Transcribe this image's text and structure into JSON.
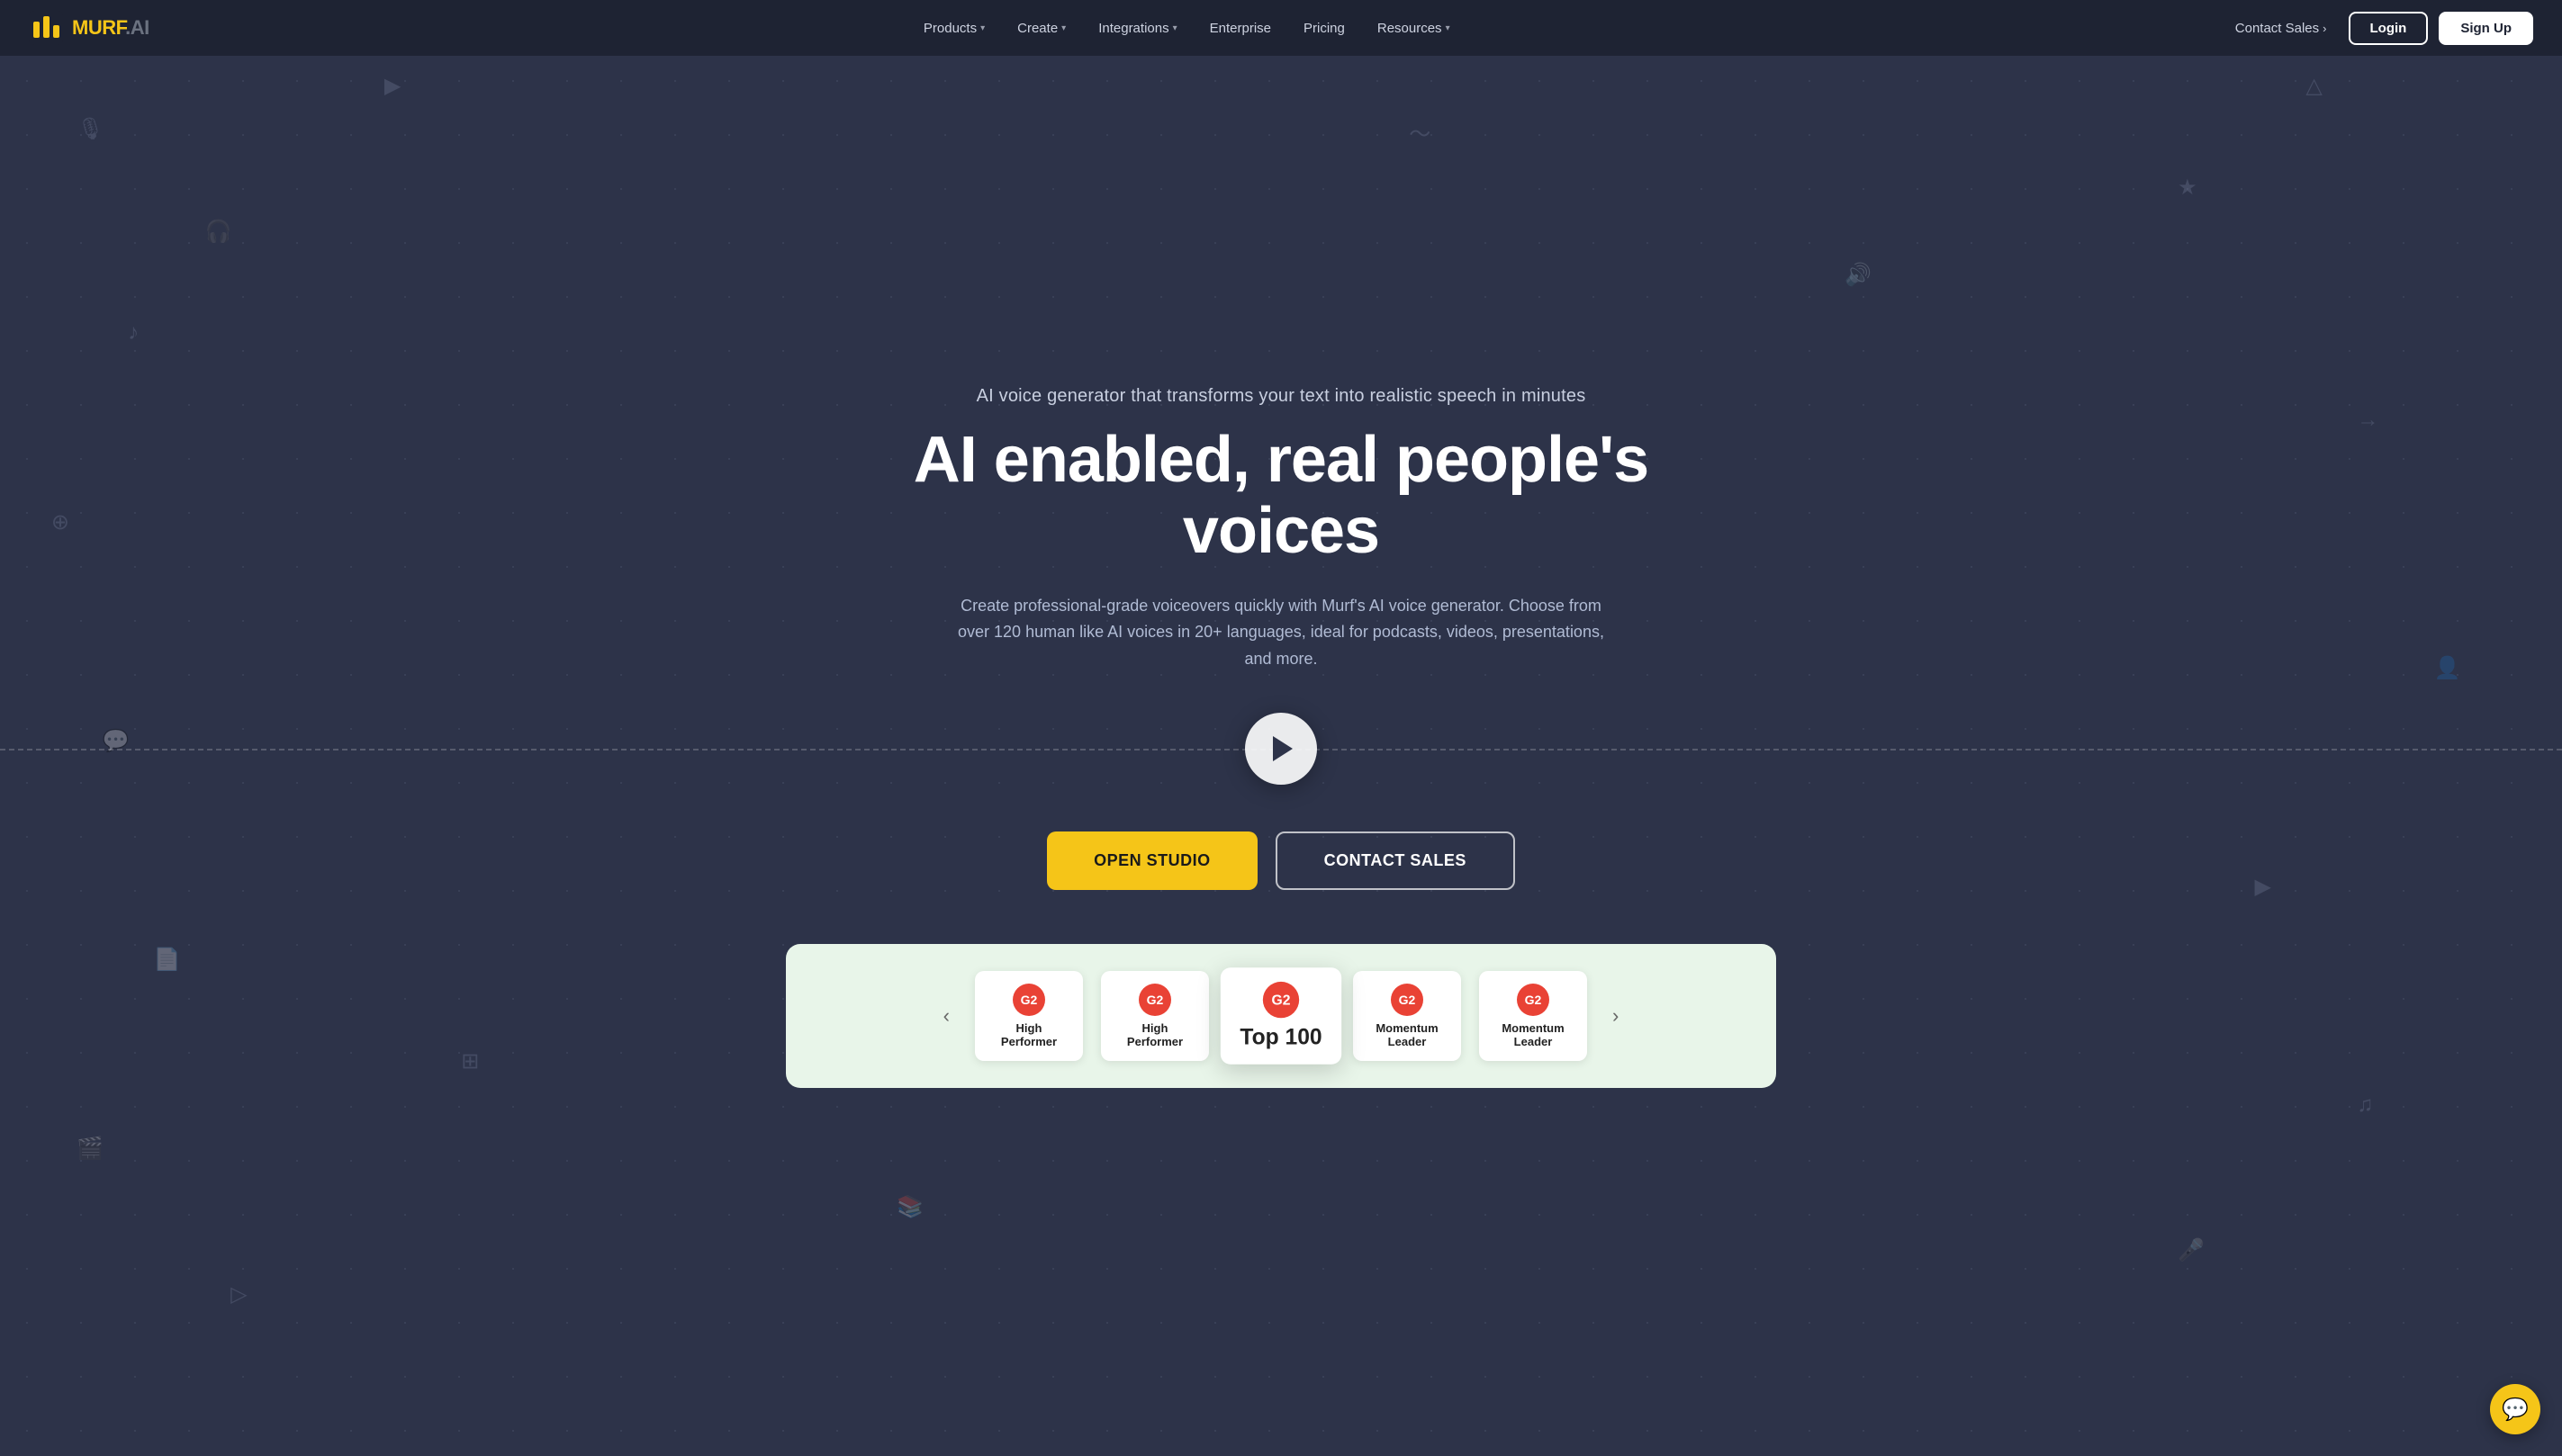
{
  "brand": {
    "name": "MURF",
    "suffix": ".AI",
    "logo_alt": "Murf.AI Logo"
  },
  "navbar": {
    "products_label": "Products",
    "create_label": "Create",
    "integrations_label": "Integrations",
    "enterprise_label": "Enterprise",
    "pricing_label": "Pricing",
    "resources_label": "Resources",
    "contact_sales_label": "Contact Sales",
    "login_label": "Login",
    "signup_label": "Sign Up"
  },
  "hero": {
    "subtitle": "AI voice generator that transforms your text into realistic speech in minutes",
    "title": "AI enabled, real people's voices",
    "description": "Create professional-grade voiceovers quickly with Murf's AI voice generator. Choose from over 120 human like AI voices in 20+ languages, ideal for podcasts, videos, presentations, and more.",
    "open_studio_label": "OPEN STUDIO",
    "contact_sales_label": "CONTACT SALES"
  },
  "badges": [
    {
      "g2_label": "G2",
      "title": "High\nPerformer"
    },
    {
      "g2_label": "G2",
      "title": "High\nPerformer"
    },
    {
      "g2_label": "G2",
      "title": "Top 100",
      "featured": true
    },
    {
      "g2_label": "G2",
      "title": "Momentum\nLeader"
    },
    {
      "g2_label": "G2",
      "title": "Momentum\nLeader"
    }
  ],
  "chat": {
    "icon": "💬"
  }
}
